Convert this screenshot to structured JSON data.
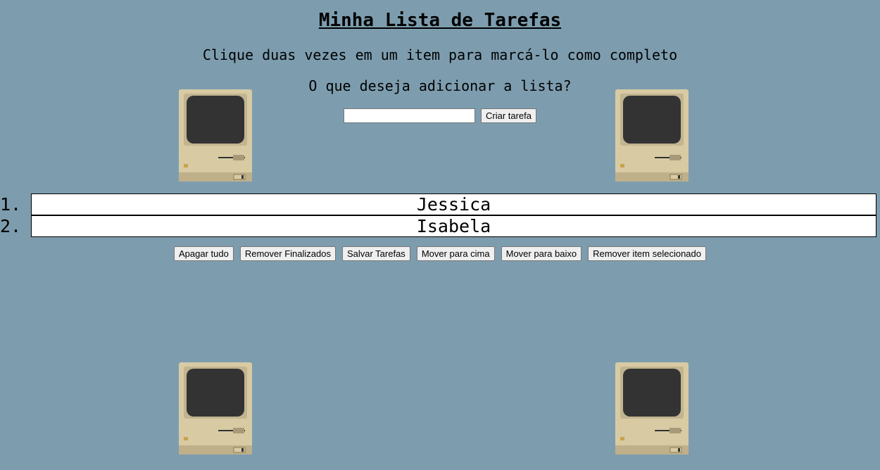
{
  "header": {
    "title": "Minha Lista de Tarefas",
    "subtitle": "Clique duas vezes em um item para marcá-lo como completo",
    "prompt": "O que deseja adicionar a lista?"
  },
  "form": {
    "input_value": "",
    "create_label": "Criar tarefa"
  },
  "tasks": [
    {
      "number": "1.",
      "label": "Jessica"
    },
    {
      "number": "2.",
      "label": "Isabela"
    }
  ],
  "actions": {
    "clear_all": "Apagar tudo",
    "remove_done": "Remover Finalizados",
    "save": "Salvar Tarefas",
    "move_up": "Mover para cima",
    "move_down": "Mover para baixo",
    "remove_selected": "Remover item selecionado"
  },
  "decorations": {
    "icon": "vintage-computer-icon",
    "background_color": "#7d9daf"
  }
}
